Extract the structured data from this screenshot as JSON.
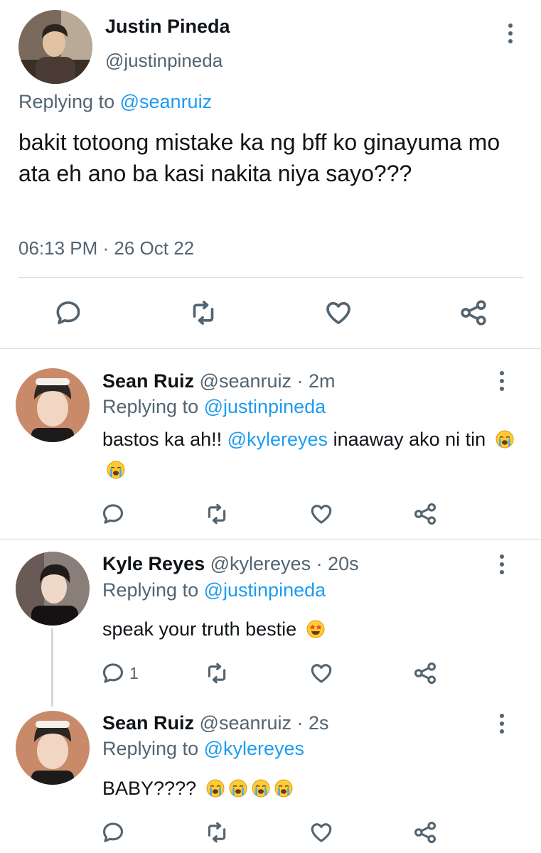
{
  "main_tweet": {
    "name": "Justin Pineda",
    "handle": "@justinpineda",
    "replying_label": "Replying to",
    "replying_to": "@seanruiz",
    "text": "bakit totoong mistake ka ng bff ko ginayuma mo ata eh ano ba kasi nakita niya sayo???",
    "timestamp": "06:13 PM · 26 Oct 22"
  },
  "replies": [
    {
      "name": "Sean Ruiz",
      "handle": "@seanruiz",
      "time": "· 2m",
      "replying_label": "Replying to",
      "replying_to": "@justinpineda",
      "text_before": "bastos ka ah!! ",
      "mention": "@kylereyes",
      "text_after": " inaaway ako ni tin",
      "emojis": [
        "loudly-crying-face",
        "loudly-crying-face"
      ]
    },
    {
      "name": "Kyle Reyes",
      "handle": "@kylereyes",
      "time": "· 20s",
      "replying_label": "Replying to",
      "replying_to": "@justinpineda",
      "text": "speak your truth bestie",
      "emojis": [
        "star-struck"
      ],
      "reply_count": "1"
    },
    {
      "name": "Sean Ruiz",
      "handle": "@seanruiz",
      "time": "· 2s",
      "replying_label": "Replying to",
      "replying_to": "@kylereyes",
      "text": "BABY????",
      "emojis": [
        "loudly-crying-face",
        "loudly-crying-face",
        "loudly-crying-face",
        "loudly-crying-face"
      ]
    }
  ],
  "colors": {
    "link": "#1d9bf0",
    "muted": "#536471",
    "divider": "#d9dde1",
    "text": "#0f1419"
  }
}
